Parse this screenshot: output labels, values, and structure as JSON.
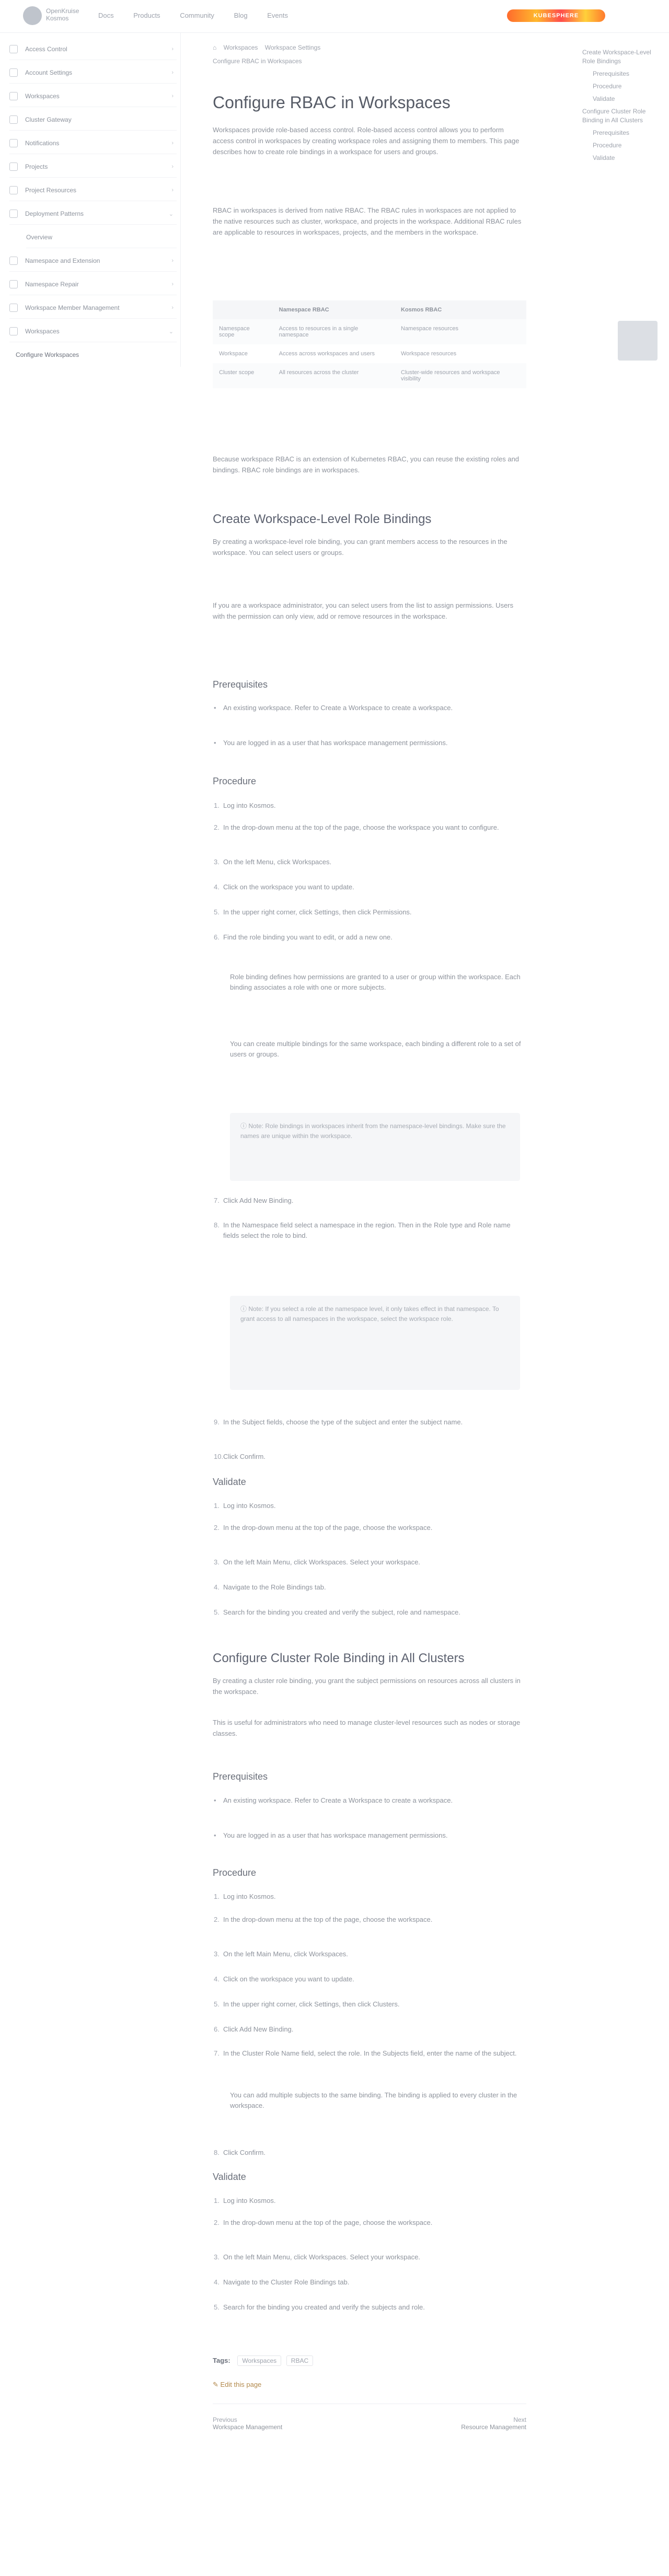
{
  "header": {
    "logo_text": "OpenKruise Kosmos",
    "nav": [
      "Docs",
      "Products",
      "Community",
      "Blog",
      "Events"
    ],
    "badge": "KUBESPHERE"
  },
  "sidebar": {
    "items": [
      "Access Control",
      "Account Settings",
      "Workspaces",
      "Cluster Gateway",
      "Notifications",
      "Projects",
      "Project Resources",
      "Deployment Patterns",
      "Overview",
      "Namespace and Extension",
      "Namespace Repair",
      "Workspace Member Management",
      "Workspaces",
      "Configure Workspaces"
    ]
  },
  "breadcrumb": [
    "Home",
    "Workspaces",
    "Workspace Settings",
    "Configure RBAC in Workspaces"
  ],
  "page": {
    "title": "Configure RBAC in Workspaces",
    "intro1": "Workspaces provide role-based access control. Role-based access control allows you to perform access control in workspaces by creating workspace roles and assigning them to members. This page describes how to create role bindings in a workspace for users and groups.",
    "intro2": "RBAC in workspaces is derived from native RBAC. The RBAC rules in workspaces are not applied to the native resources such as cluster, workspace, and projects in the workspace. Additional RBAC rules are applicable to resources in workspaces, projects, and the members in the workspace.",
    "table_headers": [
      "",
      "Namespace RBAC",
      "Kosmos RBAC"
    ],
    "table_rows": [
      [
        "Namespace scope",
        "Access to resources in a single namespace",
        "Namespace resources"
      ],
      [
        "Workspace",
        "Access across workspaces and users",
        "Workspace resources"
      ],
      [
        "Cluster scope",
        "All resources across the cluster",
        "Cluster-wide resources and workspace visibility"
      ]
    ],
    "intro3": "Because workspace RBAC is an extension of Kubernetes RBAC, you can reuse the existing roles and bindings. RBAC role bindings are in workspaces.",
    "sec1_title": "Create Workspace-Level Role Bindings",
    "sec1_p1": "By creating a workspace-level role binding, you can grant members access to the resources in the workspace. You can select users or groups.",
    "sec1_p2": "If you are a workspace administrator, you can select users from the list to assign permissions. Users with the permission can only view, add or remove resources in the workspace.",
    "prereq_title": "Prerequisites",
    "prereq1": "An existing workspace. Refer to Create a Workspace to create a workspace.",
    "prereq2": "You are logged in as a user that has workspace management permissions.",
    "proc_title": "Procedure",
    "steps1": [
      "Log into Kosmos.",
      "In the drop-down menu at the top of the page, choose the workspace you want to configure.",
      "On the left Menu, click Workspaces.",
      "Click on the workspace you want to update.",
      "In the upper right corner, click Settings, then click Permissions.",
      "Find the role binding you want to edit, or add a new one."
    ],
    "step1_detail1": "Role binding defines how permissions are granted to a user or group within the workspace. Each binding associates a role with one or more subjects.",
    "step1_detail2": "You can create multiple bindings for the same workspace, each binding a different role to a set of users or groups.",
    "note1": "Note: Role bindings in workspaces inherit from the namespace-level bindings. Make sure the names are unique within the workspace.",
    "step7": "Click Add New Binding.",
    "step8": "In the Namespace field select a namespace in the region. Then in the Role type and Role name fields select the role to bind.",
    "note2": "Note: If you select a role at the namespace level, it only takes effect in that namespace. To grant access to all namespaces in the workspace, select the workspace role.",
    "step9": "In the Subject fields, choose the type of the subject and enter the subject name.",
    "step10": "Click Confirm.",
    "validate_title": "Validate",
    "val_steps": [
      "Log into Kosmos.",
      "In the drop-down menu at the top of the page, choose the workspace.",
      "On the left Main Menu, click Workspaces. Select your workspace.",
      "Navigate to the Role Bindings tab.",
      "Search for the binding you created and verify the subject, role and namespace."
    ],
    "sec2_title": "Configure Cluster Role Binding in All Clusters",
    "sec2_p1": "By creating a cluster role binding, you grant the subject permissions on resources across all clusters in the workspace.",
    "sec2_p2": "This is useful for administrators who need to manage cluster-level resources such as nodes or storage classes.",
    "prereq3": "An existing workspace. Refer to Create a Workspace to create a workspace.",
    "prereq4": "You are logged in as a user that has workspace management permissions.",
    "steps2": [
      "Log into Kosmos.",
      "In the drop-down menu at the top of the page, choose the workspace.",
      "On the left Main Menu, click Workspaces.",
      "Click on the workspace you want to update.",
      "In the upper right corner, click Settings, then click Clusters.",
      "Click Add New Binding.",
      "In the Cluster Role Name field, select the role. In the Subjects field, enter the name of the subject.",
      "Click Confirm."
    ],
    "step2_detail": "You can add multiple subjects to the same binding. The binding is applied to every cluster in the workspace.",
    "val_steps2": [
      "Log into Kosmos.",
      "In the drop-down menu at the top of the page, choose the workspace.",
      "On the left Main Menu, click Workspaces. Select your workspace.",
      "Navigate to the Cluster Role Bindings tab.",
      "Search for the binding you created and verify the subjects and role."
    ],
    "tags_label": "Tags:",
    "tags": [
      "Workspaces",
      "RBAC"
    ],
    "edit_link": "Edit this page",
    "prev_label": "Previous",
    "prev_title": "Workspace Management",
    "next_label": "Next",
    "next_title": "Resource Management"
  },
  "toc": {
    "items": [
      "Create Workspace-Level Role Bindings",
      "Prerequisites",
      "Procedure",
      "Validate",
      "Configure Cluster Role Binding in All Clusters",
      "Prerequisites",
      "Procedure",
      "Validate"
    ]
  }
}
